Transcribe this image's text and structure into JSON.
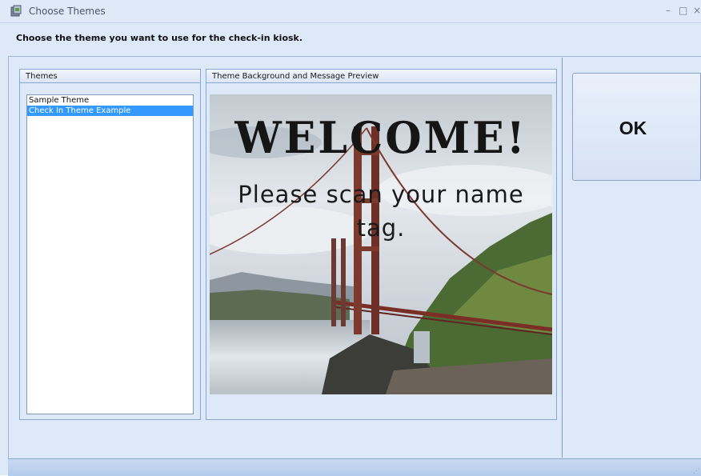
{
  "window": {
    "title": "Choose Themes",
    "controls": {
      "minimize": "–",
      "maximize": "□",
      "close": "×"
    }
  },
  "instruction": "Choose the theme you want to use for the check-in kiosk.",
  "themes_panel": {
    "header": "Themes",
    "items": [
      {
        "label": "Sample Theme",
        "selected": false
      },
      {
        "label": "Check In Theme Example",
        "selected": true
      }
    ]
  },
  "preview_panel": {
    "header": "Theme Background and Message Preview",
    "welcome_text": "WELCOME!",
    "message_text": "Please scan your name tag."
  },
  "ok_button": {
    "label": "OK"
  },
  "colors": {
    "selection": "#3399ff",
    "window_bg": "#dde8f8",
    "border": "#88a7d2"
  }
}
